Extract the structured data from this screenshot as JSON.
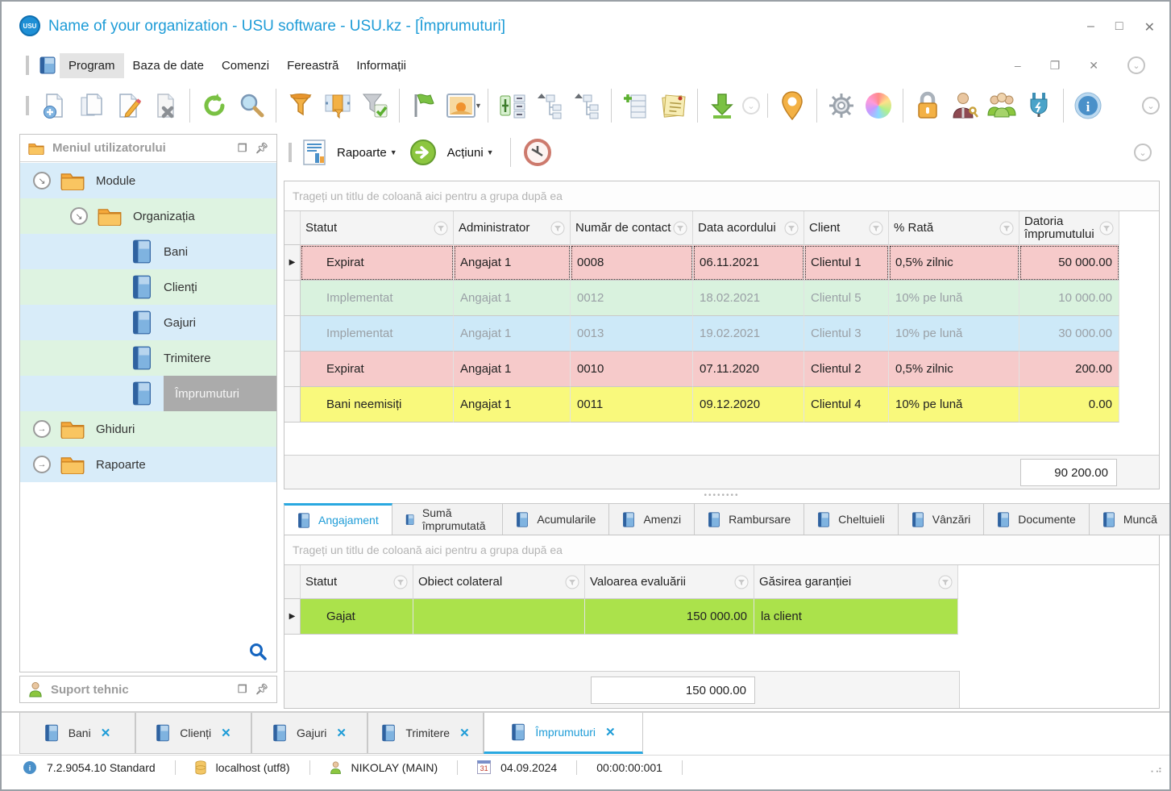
{
  "window": {
    "title": "Name of your organization - USU software - USU.kz - [Împrumuturi]",
    "logo_text": "USU"
  },
  "menu": {
    "items": [
      "Program",
      "Baza de date",
      "Comenzi",
      "Fereastră",
      "Informații"
    ]
  },
  "sidebar": {
    "title": "Meniul utilizatorului",
    "tree": [
      {
        "label": "Module"
      },
      {
        "label": "Organizația"
      },
      {
        "label": "Bani"
      },
      {
        "label": "Clienți"
      },
      {
        "label": "Gajuri"
      },
      {
        "label": "Trimitere"
      },
      {
        "label": "Împrumuturi"
      },
      {
        "label": "Ghiduri"
      },
      {
        "label": "Rapoarte"
      }
    ],
    "support_title": "Suport tehnic"
  },
  "subtoolbar": {
    "reports_label": "Rapoarte",
    "actions_label": "Acțiuni"
  },
  "grid_top": {
    "group_hint": "Trageți un titlu de coloană aici pentru a grupa după ea",
    "columns": [
      "Statut",
      "Administrator",
      "Număr de contact",
      "Data acordului",
      "Client",
      "% Rată",
      "Datoria împrumutului"
    ],
    "rows": [
      [
        "Expirat",
        "Angajat 1",
        "0008",
        "06.11.2021",
        "Clientul 1",
        "0,5% zilnic",
        "50 000.00"
      ],
      [
        "Implementat",
        "Angajat 1",
        "0012",
        "18.02.2021",
        "Clientul 5",
        "10% pe lună",
        "10 000.00"
      ],
      [
        "Implementat",
        "Angajat 1",
        "0013",
        "19.02.2021",
        "Clientul 3",
        "10% pe lună",
        "30 000.00"
      ],
      [
        "Expirat",
        "Angajat 1",
        "0010",
        "07.11.2020",
        "Clientul 2",
        "0,5% zilnic",
        "200.00"
      ],
      [
        "Bani neemisiți",
        "Angajat 1",
        "0011",
        "09.12.2020",
        "Clientul 4",
        "10% pe lună",
        "0.00"
      ]
    ],
    "total": "90 200.00"
  },
  "detail_tabs": [
    {
      "label": "Angajament"
    },
    {
      "label": "Sumă împrumutată"
    },
    {
      "label": "Acumularile"
    },
    {
      "label": "Amenzi"
    },
    {
      "label": "Rambursare"
    },
    {
      "label": "Cheltuieli"
    },
    {
      "label": "Vânzări"
    },
    {
      "label": "Documente"
    },
    {
      "label": "Muncă"
    }
  ],
  "grid_bottom": {
    "group_hint": "Trageți un titlu de coloană aici pentru a grupa după ea",
    "columns": [
      "Statut",
      "Obiect colateral",
      "Valoarea evaluării",
      "Găsirea garanției"
    ],
    "rows": [
      {
        "statut": "Gajat",
        "valoare": "150 000.00",
        "gasirea": "la client"
      }
    ],
    "total": "150 000.00"
  },
  "bottom_tabs": [
    {
      "label": "Bani",
      "close": "✕"
    },
    {
      "label": "Clienți",
      "close": "✕"
    },
    {
      "label": "Gajuri",
      "close": "✕"
    },
    {
      "label": "Trimitere",
      "close": "✕"
    },
    {
      "label": "Împrumuturi",
      "close": "✕"
    }
  ],
  "statusbar": {
    "version": "7.2.9054.10 Standard",
    "database": "localhost (utf8)",
    "user": "NIKOLAY (MAIN)",
    "calendar_day": "31",
    "date": "04.09.2024",
    "time": "00:00:00:001"
  },
  "colors": {
    "accent_blue": "#1e9cd7",
    "row_pink": "#f6caca",
    "row_green": "#d9f2de",
    "row_blue": "#cde9f8",
    "row_yellow": "#f9f97c",
    "row_lime": "#abe24b",
    "tree_blue": "#d8ecf9",
    "tree_green": "#def3e1",
    "selected_gray": "#ababab"
  }
}
